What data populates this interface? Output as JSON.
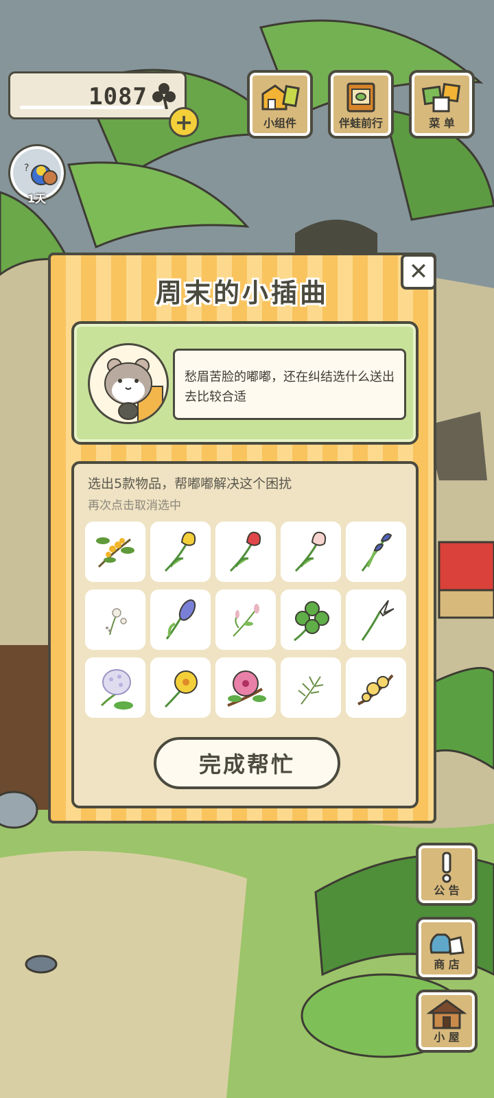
{
  "header": {
    "clover_count": "1087",
    "plus_label": "+",
    "buttons": [
      {
        "label": "小组件",
        "icon": "widget-icon"
      },
      {
        "label": "伴蛙前行",
        "icon": "journey-book-icon"
      },
      {
        "label": "菜 单",
        "icon": "menu-cards-icon"
      }
    ],
    "day_label": "1天"
  },
  "dialog": {
    "title": "周末的小插曲",
    "close_label": "✕",
    "story_text": "愁眉苦脸的嘟嘟，还在纠结选什么送出去比较合适",
    "instruction": "选出5款物品，帮嘟嘟解决这个困扰",
    "hint": "再次点击取消选中",
    "items": [
      {
        "name": "osmanthus",
        "icon": "osmanthus-icon"
      },
      {
        "name": "yellow-tulip",
        "icon": "yellow-tulip-icon"
      },
      {
        "name": "red-tulip",
        "icon": "red-tulip-icon"
      },
      {
        "name": "pink-tulip",
        "icon": "pink-tulip-icon"
      },
      {
        "name": "iris",
        "icon": "iris-icon"
      },
      {
        "name": "dandelion",
        "icon": "dandelion-icon"
      },
      {
        "name": "hyacinth",
        "icon": "hyacinth-icon"
      },
      {
        "name": "pink-sprig",
        "icon": "pink-sprig-icon"
      },
      {
        "name": "four-leaf-clover",
        "icon": "four-leaf-clover-icon"
      },
      {
        "name": "white-lily",
        "icon": "white-lily-icon"
      },
      {
        "name": "lilac",
        "icon": "lilac-icon"
      },
      {
        "name": "buttercup",
        "icon": "buttercup-icon"
      },
      {
        "name": "hibiscus",
        "icon": "hibiscus-icon"
      },
      {
        "name": "herb",
        "icon": "herb-icon"
      },
      {
        "name": "wintersweet",
        "icon": "wintersweet-icon"
      }
    ],
    "done_label": "完成帮忙"
  },
  "side": {
    "buttons": [
      {
        "label": "公 告",
        "icon": "notice-icon"
      },
      {
        "label": "商 店",
        "icon": "shop-icon"
      },
      {
        "label": "小 屋",
        "icon": "house-icon"
      }
    ]
  }
}
